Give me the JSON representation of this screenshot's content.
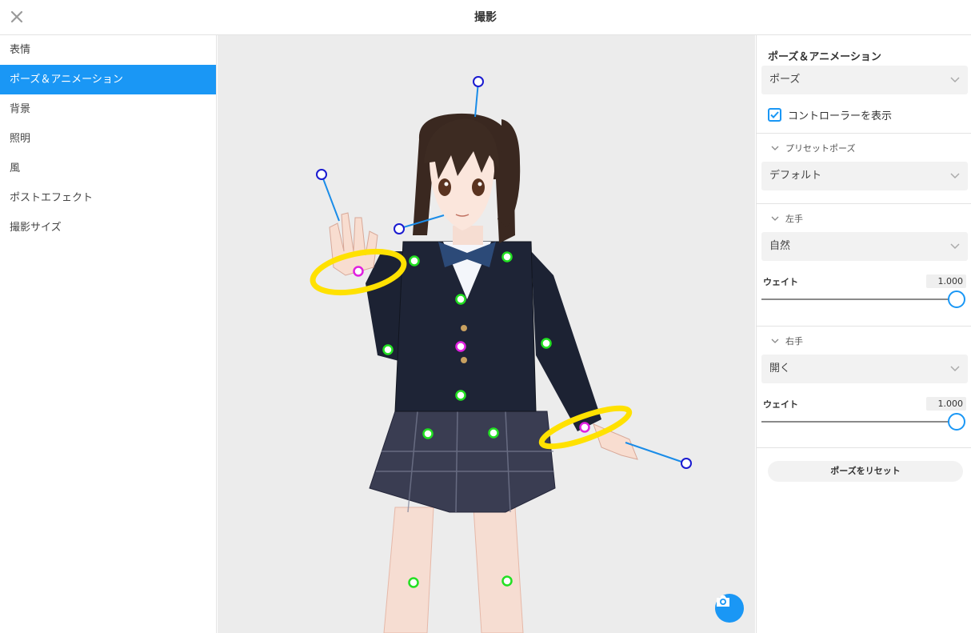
{
  "header": {
    "title": "撮影"
  },
  "sidebar": {
    "items": [
      {
        "label": "表情",
        "active": false
      },
      {
        "label": "ポーズ＆アニメーション",
        "active": true
      },
      {
        "label": "背景",
        "active": false
      },
      {
        "label": "照明",
        "active": false
      },
      {
        "label": "風",
        "active": false
      },
      {
        "label": "ポストエフェクト",
        "active": false
      },
      {
        "label": "撮影サイズ",
        "active": false
      }
    ]
  },
  "panel": {
    "title": "ポーズ＆アニメーション",
    "mode_select": "ポーズ",
    "show_controller": {
      "label": "コントローラーを表示",
      "checked": true
    },
    "preset": {
      "header": "プリセットポーズ",
      "value": "デフォルト"
    },
    "left_hand": {
      "header": "左手",
      "value": "自然",
      "weight_label": "ウェイト",
      "weight": "1.000",
      "weight_fraction": 1.0
    },
    "right_hand": {
      "header": "右手",
      "value": "開く",
      "weight_label": "ウェイト",
      "weight": "1.000",
      "weight_fraction": 1.0
    },
    "reset_label": "ポーズをリセット"
  },
  "icons": {
    "close": "close-icon",
    "camera": "camera-icon",
    "chevron_down": "chevron-down-icon",
    "check": "check-icon"
  },
  "colors": {
    "accent": "#1a97f5",
    "ring": "#ffe100",
    "joint_green": "#22e022",
    "joint_magenta": "#e020e0",
    "handle_blue": "#1a1ad0"
  }
}
